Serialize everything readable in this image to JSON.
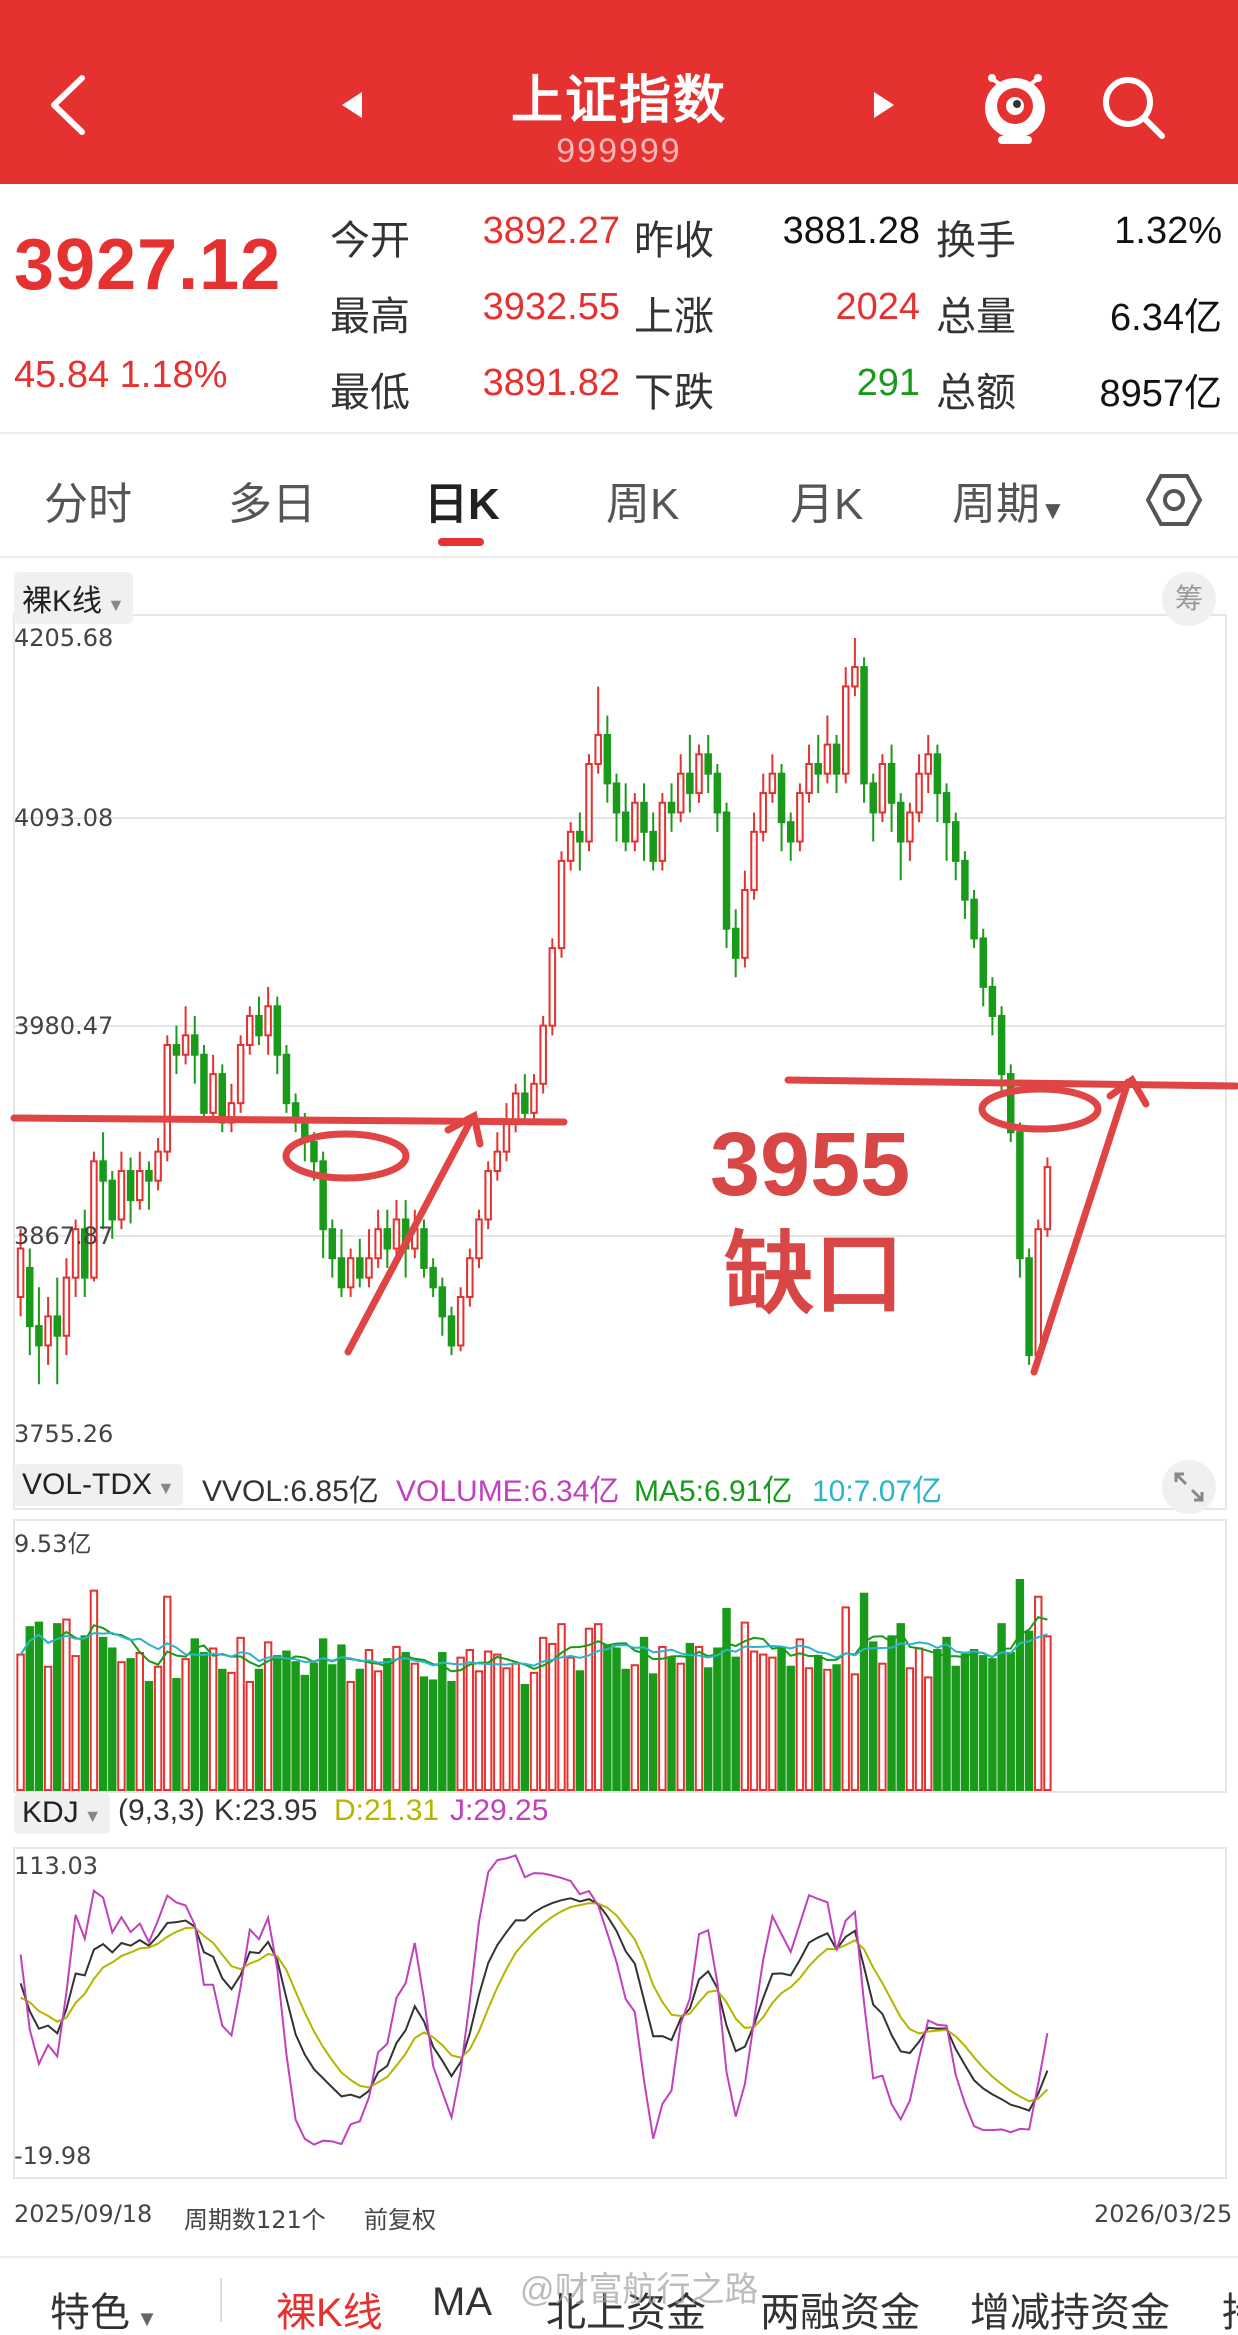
{
  "header": {
    "title": "上证指数",
    "code": "999999"
  },
  "quote": {
    "price": "3927.12",
    "change": "45.84 1.18%",
    "stats": [
      {
        "label": "今开",
        "value": "3892.27",
        "color": "red"
      },
      {
        "label": "昨收",
        "value": "3881.28",
        "color": "black"
      },
      {
        "label": "换手",
        "value": "1.32%",
        "color": "black"
      },
      {
        "label": "最高",
        "value": "3932.55",
        "color": "red"
      },
      {
        "label": "上涨",
        "value": "2024",
        "color": "red"
      },
      {
        "label": "总量",
        "value": "6.34亿",
        "color": "black"
      },
      {
        "label": "最低",
        "value": "3891.82",
        "color": "red"
      },
      {
        "label": "下跌",
        "value": "291",
        "color": "green"
      },
      {
        "label": "总额",
        "value": "8957亿",
        "color": "black"
      }
    ]
  },
  "tabs": [
    "分时",
    "多日",
    "日K",
    "周K",
    "月K",
    "周期"
  ],
  "active_tab": "日K",
  "kline": {
    "mode_label": "裸K线",
    "side_button": "筹",
    "y_ticks": [
      "4205.68",
      "4093.08",
      "3980.47",
      "3867.87",
      "3755.26"
    ],
    "annotation": {
      "line1": "3955",
      "line2": "缺口"
    }
  },
  "volume": {
    "indicator": "VOL-TDX",
    "vvol": "VVOL:6.85亿",
    "volume": "VOLUME:6.34亿",
    "ma5": "MA5:6.91亿",
    "ma10": "10:7.07亿",
    "max_label": "9.53亿"
  },
  "kdj": {
    "indicator": "KDJ",
    "params": "(9,3,3)",
    "k": "K:23.95",
    "d": "D:21.31",
    "j": "J:29.25",
    "max_label": "113.03",
    "min_label": "-19.98"
  },
  "footer": {
    "start_date": "2025/09/18",
    "period_count": "周期数121个",
    "adjust": "前复权",
    "end_date": "2026/03/25"
  },
  "bottom_nav": [
    "特色",
    "裸K线",
    "MA",
    "北上资金",
    "两融资金",
    "增减持资金",
    "持"
  ],
  "bottom_nav_active": "裸K线",
  "watermark": "@财富航行之路",
  "colors": {
    "brand": "#e5312f",
    "up": "#e5312f",
    "down": "#1a9a1a",
    "ma5": "#1a9a1a",
    "ma10": "#2ab5c8",
    "kdj_d": "#b5b500",
    "kdj_j": "#c040c0"
  },
  "chart_data": {
    "type": "candlestick",
    "ylim": [
      3755.26,
      4205.68
    ],
    "candles": [
      [
        3860,
        3885,
        3850,
        3895
      ],
      [
        3875,
        3845,
        3830,
        3885
      ],
      [
        3845,
        3835,
        3815,
        3865
      ],
      [
        3835,
        3850,
        3825,
        3860
      ],
      [
        3850,
        3840,
        3815,
        3870
      ],
      [
        3840,
        3870,
        3830,
        3880
      ],
      [
        3870,
        3895,
        3860,
        3900
      ],
      [
        3895,
        3870,
        3860,
        3905
      ],
      [
        3870,
        3930,
        3868,
        3935
      ],
      [
        3930,
        3920,
        3895,
        3945
      ],
      [
        3920,
        3900,
        3890,
        3925
      ],
      [
        3900,
        3925,
        3895,
        3935
      ],
      [
        3925,
        3910,
        3898,
        3932
      ],
      [
        3910,
        3925,
        3905,
        3935
      ],
      [
        3925,
        3920,
        3905,
        3930
      ],
      [
        3920,
        3935,
        3915,
        3942
      ],
      [
        3935,
        3990,
        3930,
        3995
      ],
      [
        3990,
        3985,
        3975,
        4000
      ],
      [
        3985,
        3995,
        3980,
        4010
      ],
      [
        3995,
        3985,
        3970,
        4005
      ],
      [
        3985,
        3955,
        3950,
        3990
      ],
      [
        3955,
        3975,
        3950,
        3985
      ],
      [
        3975,
        3950,
        3945,
        3980
      ],
      [
        3950,
        3960,
        3945,
        3970
      ],
      [
        3960,
        3990,
        3955,
        3995
      ],
      [
        3990,
        4005,
        3985,
        4010
      ],
      [
        4005,
        3995,
        3990,
        4015
      ],
      [
        3995,
        4010,
        3985,
        4020
      ],
      [
        4010,
        3985,
        3975,
        4015
      ],
      [
        3985,
        3960,
        3955,
        3990
      ],
      [
        3960,
        3950,
        3945,
        3965
      ],
      [
        3950,
        3940,
        3930,
        3955
      ],
      [
        3940,
        3930,
        3920,
        3945
      ],
      [
        3930,
        3895,
        3880,
        3935
      ],
      [
        3895,
        3880,
        3870,
        3900
      ],
      [
        3880,
        3865,
        3860,
        3895
      ],
      [
        3865,
        3880,
        3860,
        3885
      ],
      [
        3880,
        3870,
        3865,
        3890
      ],
      [
        3870,
        3880,
        3865,
        3895
      ],
      [
        3880,
        3895,
        3875,
        3905
      ],
      [
        3895,
        3885,
        3875,
        3905
      ],
      [
        3885,
        3900,
        3880,
        3910
      ],
      [
        3900,
        3885,
        3870,
        3910
      ],
      [
        3885,
        3895,
        3880,
        3905
      ],
      [
        3895,
        3875,
        3870,
        3900
      ],
      [
        3875,
        3865,
        3860,
        3880
      ],
      [
        3865,
        3850,
        3840,
        3870
      ],
      [
        3850,
        3835,
        3830,
        3855
      ],
      [
        3835,
        3860,
        3832,
        3865
      ],
      [
        3860,
        3880,
        3855,
        3885
      ],
      [
        3880,
        3900,
        3875,
        3905
      ],
      [
        3900,
        3925,
        3895,
        3930
      ],
      [
        3925,
        3935,
        3920,
        3945
      ],
      [
        3935,
        3950,
        3930,
        3960
      ],
      [
        3950,
        3965,
        3945,
        3970
      ],
      [
        3965,
        3955,
        3950,
        3975
      ],
      [
        3955,
        3970,
        3950,
        3975
      ],
      [
        3970,
        4000,
        3965,
        4005
      ],
      [
        4000,
        4040,
        3995,
        4045
      ],
      [
        4040,
        4085,
        4035,
        4090
      ],
      [
        4085,
        4100,
        4080,
        4105
      ],
      [
        4100,
        4095,
        4080,
        4110
      ],
      [
        4095,
        4135,
        4090,
        4140
      ],
      [
        4135,
        4150,
        4130,
        4175
      ],
      [
        4150,
        4125,
        4115,
        4160
      ],
      [
        4125,
        4110,
        4095,
        4130
      ],
      [
        4110,
        4095,
        4090,
        4125
      ],
      [
        4095,
        4115,
        4090,
        4120
      ],
      [
        4115,
        4100,
        4085,
        4125
      ],
      [
        4100,
        4085,
        4080,
        4110
      ],
      [
        4085,
        4115,
        4080,
        4120
      ],
      [
        4115,
        4110,
        4100,
        4125
      ],
      [
        4110,
        4130,
        4105,
        4140
      ],
      [
        4130,
        4120,
        4110,
        4150
      ],
      [
        4120,
        4140,
        4115,
        4145
      ],
      [
        4140,
        4130,
        4120,
        4150
      ],
      [
        4130,
        4110,
        4100,
        4135
      ],
      [
        4110,
        4050,
        4040,
        4115
      ],
      [
        4050,
        4035,
        4025,
        4060
      ],
      [
        4035,
        4070,
        4030,
        4080
      ],
      [
        4070,
        4100,
        4065,
        4110
      ],
      [
        4100,
        4120,
        4095,
        4130
      ],
      [
        4120,
        4130,
        4115,
        4140
      ],
      [
        4130,
        4105,
        4090,
        4135
      ],
      [
        4105,
        4095,
        4085,
        4110
      ],
      [
        4095,
        4120,
        4090,
        4125
      ],
      [
        4120,
        4135,
        4115,
        4145
      ],
      [
        4135,
        4130,
        4120,
        4150
      ],
      [
        4130,
        4145,
        4125,
        4160
      ],
      [
        4145,
        4130,
        4120,
        4150
      ],
      [
        4130,
        4175,
        4125,
        4185
      ],
      [
        4175,
        4185,
        4170,
        4200
      ],
      [
        4185,
        4125,
        4115,
        4190
      ],
      [
        4125,
        4110,
        4095,
        4130
      ],
      [
        4110,
        4135,
        4105,
        4140
      ],
      [
        4135,
        4115,
        4100,
        4145
      ],
      [
        4115,
        4095,
        4075,
        4120
      ],
      [
        4095,
        4110,
        4085,
        4115
      ],
      [
        4110,
        4130,
        4105,
        4140
      ],
      [
        4130,
        4140,
        4120,
        4150
      ],
      [
        4140,
        4120,
        4105,
        4145
      ],
      [
        4120,
        4105,
        4085,
        4125
      ],
      [
        4105,
        4085,
        4075,
        4110
      ],
      [
        4085,
        4065,
        4055,
        4090
      ],
      [
        4065,
        4045,
        4040,
        4070
      ],
      [
        4045,
        4020,
        4010,
        4050
      ],
      [
        4020,
        4005,
        3995,
        4025
      ],
      [
        4005,
        3975,
        3965,
        4010
      ],
      [
        3975,
        3945,
        3940,
        3980
      ],
      [
        3945,
        3880,
        3870,
        3950
      ],
      [
        3880,
        3830,
        3825,
        3885
      ],
      [
        3830,
        3895,
        3825,
        3900
      ],
      [
        3895,
        3927,
        3891,
        3932
      ]
    ]
  }
}
